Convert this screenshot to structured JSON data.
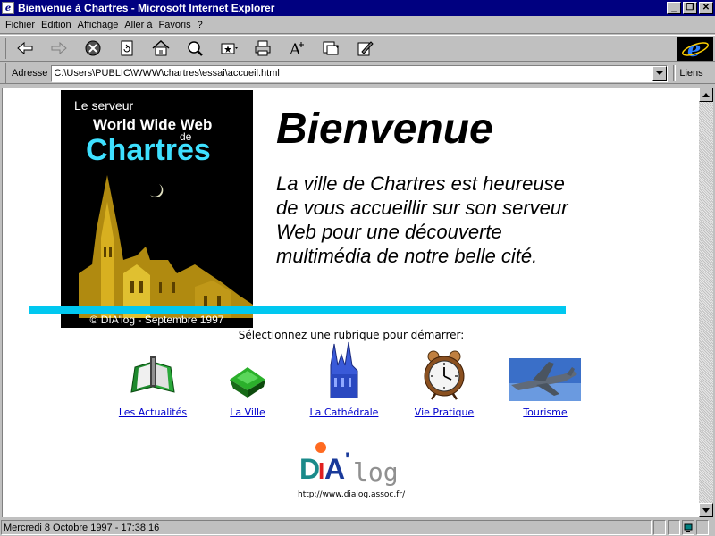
{
  "window": {
    "title": "Bienvenue à Chartres - Microsoft Internet Explorer",
    "minimize_glyph": "_",
    "maximize_glyph": "❐",
    "close_glyph": "✕"
  },
  "menu": {
    "items": [
      "Fichier",
      "Edition",
      "Affichage",
      "Aller à",
      "Favoris",
      "?"
    ]
  },
  "toolbar": {
    "buttons": [
      "back-icon",
      "forward-icon",
      "stop-icon",
      "refresh-icon",
      "home-icon",
      "search-icon",
      "favorites-icon",
      "print-icon",
      "font-icon",
      "mail-icon",
      "edit-icon"
    ],
    "brand_icon": "ie-logo-icon"
  },
  "address": {
    "label": "Adresse",
    "url": "C:\\Users\\PUBLIC\\WWW\\chartres\\essai\\accueil.html",
    "links_label": "Liens"
  },
  "page": {
    "hero": {
      "line1": "Le serveur",
      "line2": "World Wide Web",
      "line3": "de",
      "line4": "Chartres",
      "copyright": "© DIA'log - Septembre 1997"
    },
    "heading": "Bienvenue",
    "intro": "La ville de Chartres est heureuse de vous accueillir sur son serveur Web pour une découverte multimédia de notre belle cité.",
    "prompt": "Sélectionnez une rubrique pour démarrer:",
    "sections": [
      {
        "label": "Les Actualités",
        "icon": "book-icon"
      },
      {
        "label": "La Ville",
        "icon": "house-icon"
      },
      {
        "label": "La Cathédrale",
        "icon": "cathedral-icon"
      },
      {
        "label": "Vie Pratique",
        "icon": "alarm-clock-icon"
      },
      {
        "label": "Tourisme",
        "icon": "airplane-icon"
      }
    ],
    "dialog": {
      "logo_text": "DIA'log",
      "url": "http://www.dialog.assoc.fr/"
    }
  },
  "colors": {
    "titlebar": "#000080",
    "accent_cyan": "#00c8f0",
    "link": "#0000cc"
  },
  "status": {
    "text": "Mercredi 8 Octobre 1997 - 17:38:16"
  }
}
